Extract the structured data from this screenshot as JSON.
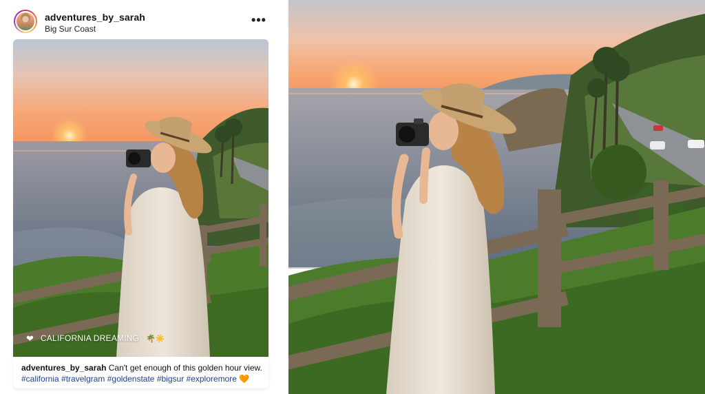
{
  "post": {
    "username": "adventures_by_sarah",
    "location": "Big Sur Coast",
    "more_icon": "more-horizontal-icon",
    "overlay": {
      "icon": "heart-icon",
      "text": "CALIFORNIA DREAMING",
      "emojis": "🌴☀️"
    },
    "caption": {
      "username": "adventures_by_sarah",
      "text": "Can't get enough of this golden hour view.",
      "hashtags": [
        "#california",
        "#travelgram",
        "#goldenstate",
        "#bigsur",
        "#exploremore"
      ],
      "end_emoji": "🧡"
    }
  },
  "colors": {
    "hashtag": "#1e3f8a",
    "sky_top": "#f2c6a6",
    "sun": "#ffb25a",
    "ocean": "#6f7b8d",
    "grass": "#4f7f2c"
  }
}
